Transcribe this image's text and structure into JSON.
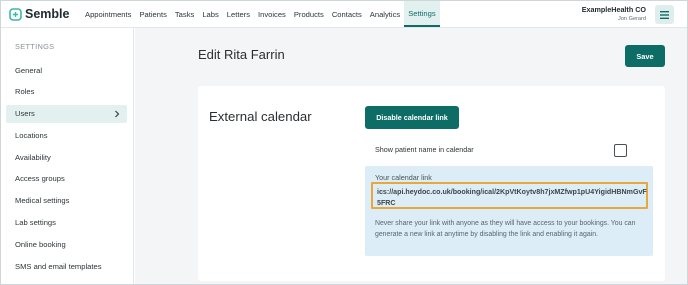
{
  "app": {
    "brand": "Semble"
  },
  "nav": {
    "items": [
      {
        "label": "Appointments"
      },
      {
        "label": "Patients"
      },
      {
        "label": "Tasks"
      },
      {
        "label": "Labs"
      },
      {
        "label": "Letters"
      },
      {
        "label": "Invoices"
      },
      {
        "label": "Products"
      },
      {
        "label": "Contacts"
      },
      {
        "label": "Analytics"
      },
      {
        "label": "Settings",
        "active": true
      }
    ]
  },
  "account": {
    "org_name": "ExampleHealth CO",
    "user_name": "Jon Gerard",
    "menu_icon": "hamburger-icon"
  },
  "sidebar": {
    "heading": "SETTINGS",
    "items": [
      {
        "label": "General"
      },
      {
        "label": "Roles"
      },
      {
        "label": "Users",
        "active": true
      },
      {
        "label": "Locations"
      },
      {
        "label": "Availability"
      },
      {
        "label": "Access groups"
      },
      {
        "label": "Medical settings"
      },
      {
        "label": "Lab settings"
      },
      {
        "label": "Online booking"
      },
      {
        "label": "SMS and email templates"
      }
    ]
  },
  "page": {
    "title": "Edit Rita Farrin",
    "save_label": "Save"
  },
  "calendar": {
    "section_title": "External calendar",
    "disable_label": "Disable calendar link",
    "show_patient_label": "Show patient name in calendar",
    "show_patient_checked": false,
    "link_label": "Your calendar link",
    "link_url": "ics://api.heydoc.co.uk/booking/ical/2KpVtKoytv8h7jxMZfwp1pU4YigidHBNmGvF5FRC",
    "warning": "Never share your link with anyone as they will have access to your bookings. You can generate a new link at anytime by disabling the link and enabling it again."
  },
  "colors": {
    "brand": "#0e6c66",
    "active_bg": "#e2f1ef",
    "info_bg": "#dcedf8",
    "highlight": "#e8a93a"
  }
}
